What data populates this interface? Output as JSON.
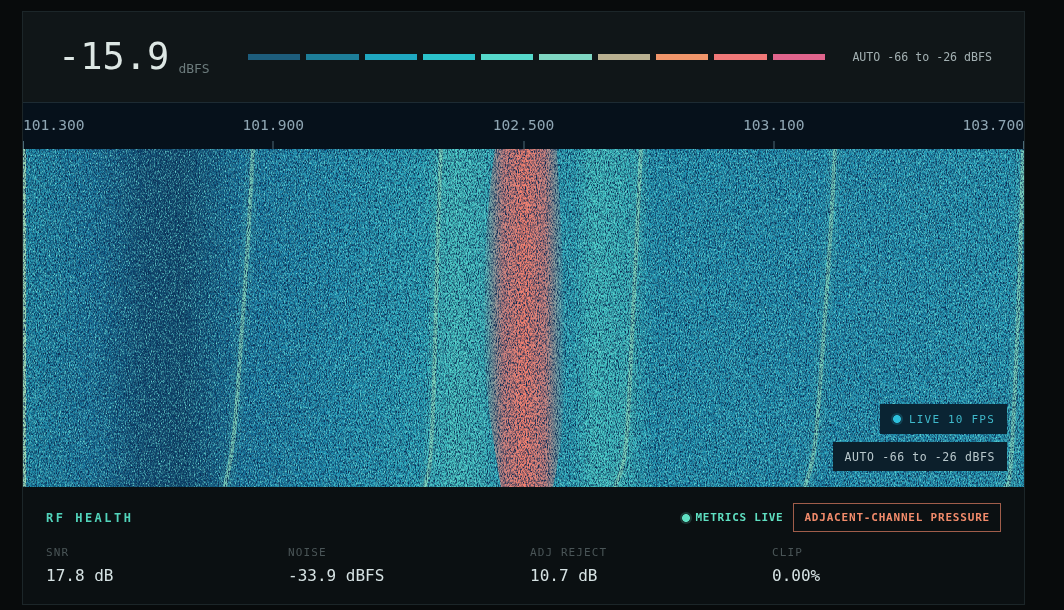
{
  "header": {
    "reading": "-15.9",
    "unit": "dBFS",
    "color_scale": [
      {
        "color": "#1d5d7c"
      },
      {
        "color": "#1d7e99"
      },
      {
        "color": "#1fa8c1"
      },
      {
        "color": "#2bc2cb"
      },
      {
        "color": "#56d9cb"
      },
      {
        "color": "#7fd6c2"
      },
      {
        "color": "#b9b090"
      },
      {
        "color": "#f0956a"
      },
      {
        "color": "#f07878"
      },
      {
        "color": "#e0648c"
      }
    ],
    "scale_label": "AUTO -66 to -26 dBFS"
  },
  "frequency_axis": {
    "labels": [
      "101.300",
      "101.900",
      "102.500",
      "103.100",
      "103.700"
    ]
  },
  "waterfall": {
    "overlays": [
      {
        "kind": "live",
        "label": "LIVE 10 FPS"
      },
      {
        "kind": "scale",
        "label": "AUTO -66 to -26 dBFS"
      }
    ]
  },
  "rf_health": {
    "title": "RF HEALTH",
    "status": "METRICS LIVE",
    "alert": "ADJACENT-CHANNEL PRESSURE",
    "metrics": [
      {
        "label": "SNR",
        "value": "17.8 dB"
      },
      {
        "label": "NOISE",
        "value": "-33.9 dBFS"
      },
      {
        "label": "ADJ REJECT",
        "value": "10.7 dB"
      },
      {
        "label": "CLIP",
        "value": "0.00%"
      }
    ]
  }
}
